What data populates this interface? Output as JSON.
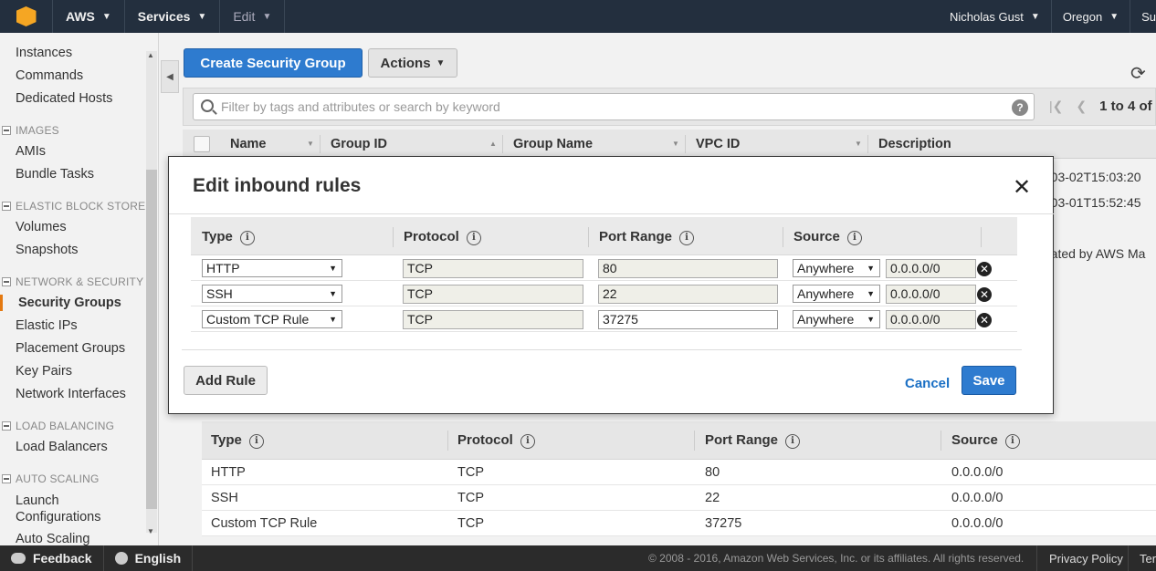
{
  "topbar": {
    "brand": "AWS",
    "services": "Services",
    "edit": "Edit",
    "user": "Nicholas Gust",
    "region": "Oregon",
    "support": "Su"
  },
  "sidebar": {
    "items_top": [
      "Instances",
      "Commands",
      "Dedicated Hosts"
    ],
    "sec_images": "IMAGES",
    "images": [
      "AMIs",
      "Bundle Tasks"
    ],
    "sec_ebs": "ELASTIC BLOCK STORE",
    "ebs": [
      "Volumes",
      "Snapshots"
    ],
    "sec_net": "NETWORK & SECURITY",
    "net": [
      "Security Groups",
      "Elastic IPs",
      "Placement Groups",
      "Key Pairs",
      "Network Interfaces"
    ],
    "sec_lb": "LOAD BALANCING",
    "lb": [
      "Load Balancers"
    ],
    "sec_as": "AUTO SCALING",
    "as": [
      "Launch Configurations",
      "Auto Scaling"
    ]
  },
  "toolbar": {
    "create": "Create Security Group",
    "actions": "Actions"
  },
  "filter": {
    "placeholder": "Filter by tags and attributes or search by keyword",
    "help": "?",
    "count": "1 to 4 of"
  },
  "grid": {
    "columns": [
      "Name",
      "Group ID",
      "Group Name",
      "VPC ID",
      "Description"
    ],
    "bg_rows": [
      "-03-02T15:03:20",
      "-03-01T15:52:45",
      "rated by AWS Ma"
    ]
  },
  "modal": {
    "title": "Edit inbound rules",
    "columns": [
      "Type",
      "Protocol",
      "Port Range",
      "Source"
    ],
    "rules": [
      {
        "type": "HTTP",
        "protocol": "TCP",
        "port": "80",
        "source": "Anywhere",
        "cidr": "0.0.0.0/0"
      },
      {
        "type": "SSH",
        "protocol": "TCP",
        "port": "22",
        "source": "Anywhere",
        "cidr": "0.0.0.0/0"
      },
      {
        "type": "Custom TCP Rule",
        "protocol": "TCP",
        "port": "37275",
        "source": "Anywhere",
        "cidr": "0.0.0.0/0"
      }
    ],
    "add_rule": "Add Rule",
    "cancel": "Cancel",
    "save": "Save"
  },
  "bottom": {
    "columns": [
      "Type",
      "Protocol",
      "Port Range",
      "Source"
    ],
    "rows": [
      [
        "HTTP",
        "TCP",
        "80",
        "0.0.0.0/0"
      ],
      [
        "SSH",
        "TCP",
        "22",
        "0.0.0.0/0"
      ],
      [
        "Custom TCP Rule",
        "TCP",
        "37275",
        "0.0.0.0/0"
      ]
    ]
  },
  "footer": {
    "feedback": "Feedback",
    "language": "English",
    "copyright": "© 2008 - 2016, Amazon Web Services, Inc. or its affiliates. All rights reserved.",
    "privacy": "Privacy Policy",
    "terms": "Ter"
  }
}
